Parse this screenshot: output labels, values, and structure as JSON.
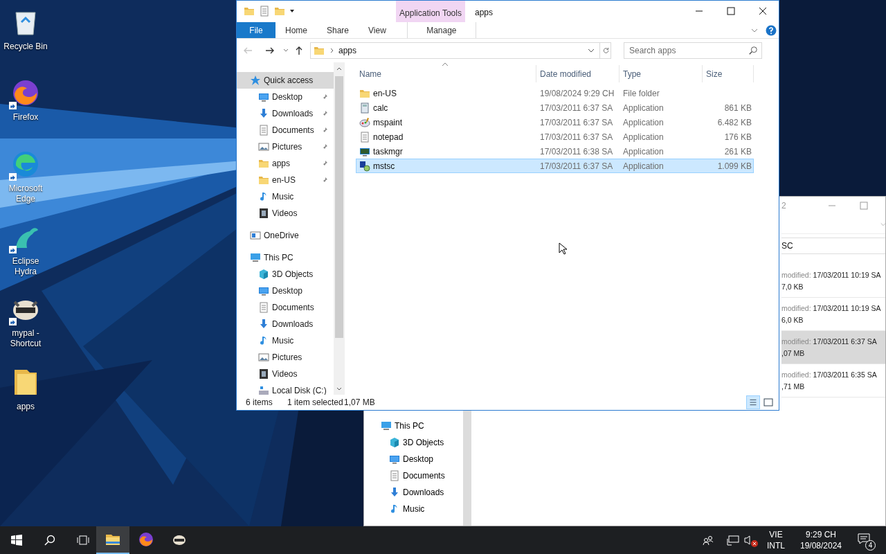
{
  "desktop_icons": [
    {
      "label": "Recycle Bin",
      "kind": "recycle",
      "shortcut": false
    },
    {
      "label": "Firefox",
      "kind": "firefox",
      "shortcut": true
    },
    {
      "label": "Microsoft Edge",
      "kind": "edge",
      "shortcut": true
    },
    {
      "label": "Eclipse Hydra",
      "kind": "hydra",
      "shortcut": true
    },
    {
      "label": "mypal - Shortcut",
      "kind": "raccoon",
      "shortcut": true
    },
    {
      "label": "apps",
      "kind": "folder",
      "shortcut": false
    }
  ],
  "background_window": {
    "title": "2",
    "search_value": "SC",
    "files": [
      {
        "label": "modified:",
        "date": "17/03/2011 10:19 SA",
        "size": "7,0 KB",
        "selected": false
      },
      {
        "label": "modified:",
        "date": "17/03/2011 10:19 SA",
        "size": "6,0 KB",
        "selected": false
      },
      {
        "label": "modified:",
        "date": "17/03/2011 6:37 SA",
        "size": ",07 MB",
        "selected": true
      },
      {
        "label": "modified:",
        "date": "17/03/2011 6:35 SA",
        "size": ",71 MB",
        "selected": false
      }
    ],
    "nav": [
      {
        "label": "This PC",
        "kind": "pc",
        "children": [
          {
            "label": "3D Objects",
            "kind": "cube"
          },
          {
            "label": "Desktop",
            "kind": "desktop"
          },
          {
            "label": "Documents",
            "kind": "documents"
          },
          {
            "label": "Downloads",
            "kind": "downloads"
          },
          {
            "label": "Music",
            "kind": "music"
          }
        ]
      }
    ]
  },
  "explorer": {
    "title": "apps",
    "context_tab": "Application Tools",
    "tabs": [
      {
        "label": "File",
        "kind": "file"
      },
      {
        "label": "Home",
        "kind": "plain"
      },
      {
        "label": "Share",
        "kind": "plain"
      },
      {
        "label": "View",
        "kind": "plain"
      },
      {
        "label": "Manage",
        "kind": "context"
      }
    ],
    "address": {
      "path": "apps"
    },
    "search": {
      "placeholder": "Search apps"
    },
    "nav": [
      {
        "label": "Quick access",
        "kind": "star",
        "selected": true,
        "children": [
          {
            "label": "Desktop",
            "kind": "desktop",
            "pinned": true,
            "selected": false
          },
          {
            "label": "Downloads",
            "kind": "downloads",
            "pinned": true,
            "selected": false
          },
          {
            "label": "Documents",
            "kind": "documents",
            "pinned": true,
            "selected": false
          },
          {
            "label": "Pictures",
            "kind": "pictures",
            "pinned": true,
            "selected": false
          },
          {
            "label": "apps",
            "kind": "folder",
            "pinned": true,
            "selected": false
          },
          {
            "label": "en-US",
            "kind": "folder",
            "pinned": true,
            "selected": false
          },
          {
            "label": "Music",
            "kind": "music",
            "pinned": false,
            "selected": false
          },
          {
            "label": "Videos",
            "kind": "videos",
            "pinned": false,
            "selected": false
          }
        ]
      },
      {
        "label": "OneDrive",
        "kind": "cloud",
        "selected": false
      },
      {
        "label": "This PC",
        "kind": "pc",
        "selected": false,
        "children": [
          {
            "label": "3D Objects",
            "kind": "cube",
            "pinned": false,
            "selected": false
          },
          {
            "label": "Desktop",
            "kind": "desktop",
            "pinned": false,
            "selected": false
          },
          {
            "label": "Documents",
            "kind": "documents",
            "pinned": false,
            "selected": false
          },
          {
            "label": "Downloads",
            "kind": "downloads",
            "pinned": false,
            "selected": false
          },
          {
            "label": "Music",
            "kind": "music",
            "pinned": false,
            "selected": false
          },
          {
            "label": "Pictures",
            "kind": "pictures",
            "pinned": false,
            "selected": false
          },
          {
            "label": "Videos",
            "kind": "videos",
            "pinned": false,
            "selected": false
          },
          {
            "label": "Local Disk (C:)",
            "kind": "disk",
            "pinned": false,
            "selected": false
          }
        ]
      }
    ],
    "columns": [
      "Name",
      "Date modified",
      "Type",
      "Size"
    ],
    "rows": [
      {
        "name": "en-US",
        "kind": "folder",
        "date": "19/08/2024 9:29 CH",
        "type": "File folder",
        "selected": false
      },
      {
        "name": "calc",
        "kind": "calc",
        "date": "17/03/2011 6:37 SA",
        "type": "Application",
        "size": "861 KB",
        "selected": false
      },
      {
        "name": "mspaint",
        "kind": "paint",
        "date": "17/03/2011 6:37 SA",
        "type": "Application",
        "size": "6.482 KB",
        "selected": false
      },
      {
        "name": "notepad",
        "kind": "notepad",
        "date": "17/03/2011 6:37 SA",
        "type": "Application",
        "size": "176 KB",
        "selected": false
      },
      {
        "name": "taskmgr",
        "kind": "taskmgr",
        "date": "17/03/2011 6:38 SA",
        "type": "Application",
        "size": "261 KB",
        "selected": false
      },
      {
        "name": "mstsc",
        "kind": "remote",
        "date": "17/03/2011 6:37 SA",
        "type": "Application",
        "size": "1.099 KB",
        "selected": true
      }
    ],
    "status": {
      "count": "6 items",
      "selection": "1 item selected",
      "size": "1,07 MB"
    }
  },
  "taskbar": {
    "apps": [
      {
        "kind": "explorer",
        "active": true
      },
      {
        "kind": "firefox",
        "active": false
      },
      {
        "kind": "raccoon",
        "active": false
      }
    ],
    "language": "VIE",
    "layout": "INTL",
    "time": "9:29 CH",
    "date": "19/08/2024",
    "notifications": "4",
    "muted": true
  }
}
